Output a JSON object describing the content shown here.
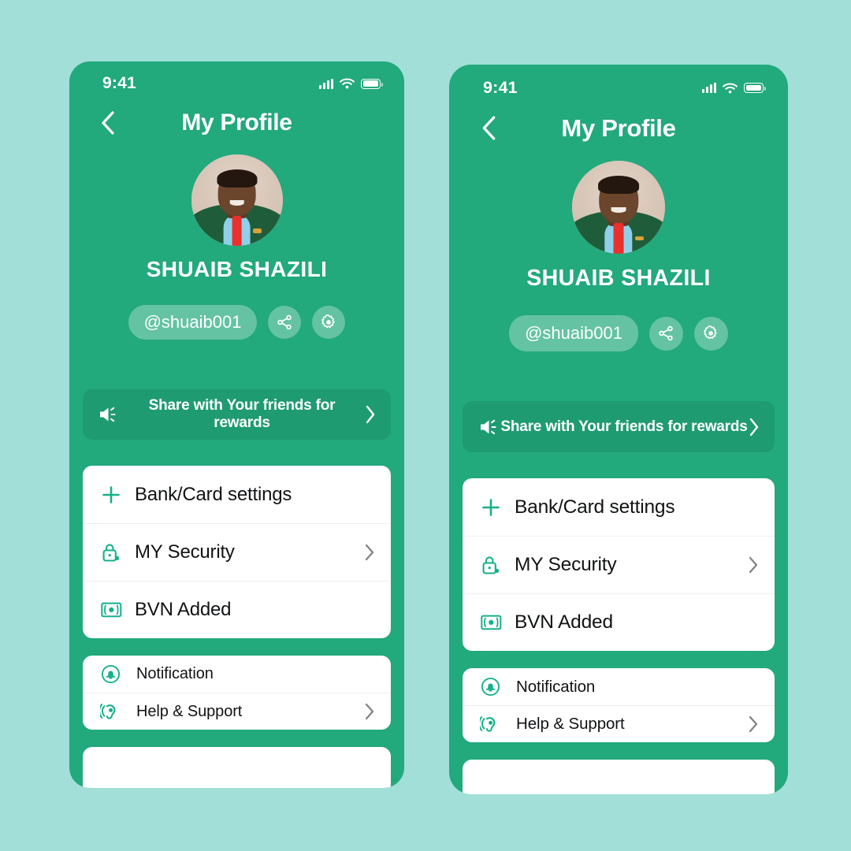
{
  "theme": {
    "page_background": "#a2dfd9",
    "phone_background": "#22a97c",
    "banner_background": "#1f9b71",
    "card_background": "#ffffff",
    "accent_icon_color": "#16b08a",
    "text_primary": "#111315",
    "text_on_green": "#ffffff"
  },
  "screens": [
    {
      "id": "screen-left",
      "status_bar": {
        "time": "9:41",
        "icons": [
          "signal-icon",
          "wifi-icon",
          "battery-icon"
        ]
      },
      "nav": {
        "back_icon": "chevron-left-icon",
        "title": "My Profile"
      },
      "profile": {
        "avatar_alt": "Profile photo of man in green suit and red tie",
        "name": "SHUAIB SHAZILI",
        "handle": "@shuaib001",
        "share_icon": "share-icon",
        "settings_icon": "gear-icon"
      },
      "share_banner": {
        "icon": "megaphone-icon",
        "label": "Share with Your friends for rewards",
        "chevron": "chevron-right-icon"
      },
      "main_card": [
        {
          "icon": "plus-icon",
          "label": "Bank/Card settings",
          "chevron": false
        },
        {
          "icon": "lock-icon",
          "label": "MY Security",
          "chevron": true
        },
        {
          "icon": "banknote-icon",
          "label": "BVN Added",
          "chevron": false
        }
      ],
      "secondary_card": [
        {
          "icon": "bell-icon",
          "label": "Notification",
          "chevron": false
        },
        {
          "icon": "ear-support-icon",
          "label": "Help & Support",
          "chevron": true
        }
      ],
      "footer_card": {
        "label": ""
      }
    },
    {
      "id": "screen-right",
      "status_bar": {
        "time": "9:41",
        "icons": [
          "signal-icon",
          "wifi-icon",
          "battery-icon"
        ]
      },
      "nav": {
        "back_icon": "chevron-left-icon",
        "title": "My Profile"
      },
      "profile": {
        "avatar_alt": "Profile photo of man in green suit and red tie",
        "name": "SHUAIB SHAZILI",
        "handle": "@shuaib001",
        "share_icon": "share-icon",
        "settings_icon": "gear-icon"
      },
      "share_banner": {
        "icon": "megaphone-icon",
        "label": "Share with Your friends for rewards",
        "chevron": "chevron-right-icon"
      },
      "main_card": [
        {
          "icon": "plus-icon",
          "label": "Bank/Card settings",
          "chevron": false
        },
        {
          "icon": "lock-icon",
          "label": "MY Security",
          "chevron": true
        },
        {
          "icon": "banknote-icon",
          "label": "BVN Added",
          "chevron": false
        }
      ],
      "secondary_card": [
        {
          "icon": "bell-icon",
          "label": "Notification",
          "chevron": false
        },
        {
          "icon": "ear-support-icon",
          "label": "Help & Support",
          "chevron": true
        }
      ],
      "footer_card": {
        "label": ""
      }
    }
  ]
}
